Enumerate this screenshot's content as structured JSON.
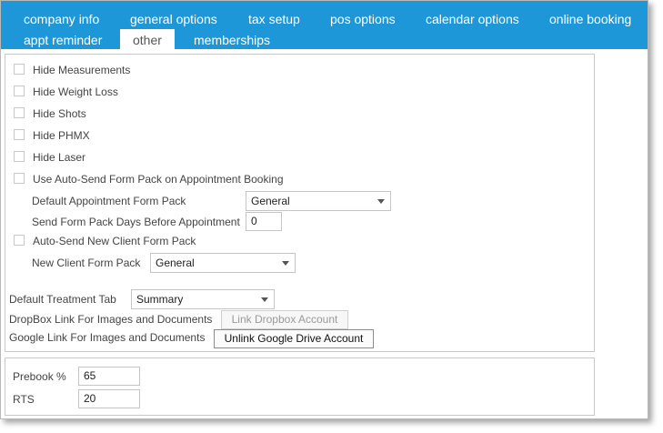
{
  "tabs": {
    "row1": [
      "company info",
      "general options",
      "tax setup",
      "pos options",
      "calendar options",
      "online booking"
    ],
    "row2": [
      "appt reminder",
      "other",
      "memberships"
    ],
    "active": "other"
  },
  "colors": {
    "tabbar": "#1e97d8",
    "panel_border": "#c8c8c8"
  },
  "options": {
    "checkboxes": [
      {
        "label": "Hide Measurements",
        "checked": false
      },
      {
        "label": "Hide Weight Loss",
        "checked": false
      },
      {
        "label": "Hide Shots",
        "checked": false
      },
      {
        "label": "Hide PHMX",
        "checked": false
      },
      {
        "label": "Hide Laser",
        "checked": false
      },
      {
        "label": "Use Auto-Send Form Pack on Appointment Booking",
        "checked": false
      }
    ],
    "default_appt_form_pack": {
      "label": "Default Appointment Form Pack",
      "value": "General"
    },
    "send_days": {
      "label": "Send Form Pack Days Before Appointment",
      "value": "0"
    },
    "auto_send_new_client": {
      "label": "Auto-Send New Client Form Pack",
      "checked": false
    },
    "new_client_form_pack": {
      "label": "New Client Form Pack",
      "value": "General"
    },
    "default_treatment_tab": {
      "label": "Default Treatment Tab",
      "value": "Summary"
    },
    "dropbox": {
      "label": "DropBox Link For Images and Documents",
      "button": "Link Dropbox Account"
    },
    "google": {
      "label": "Google Link For Images and Documents",
      "button": "Unlink Google Drive Account"
    }
  },
  "prebook": {
    "prebook_label": "Prebook %",
    "prebook_value": "65",
    "rts_label": "RTS",
    "rts_value": "20"
  }
}
